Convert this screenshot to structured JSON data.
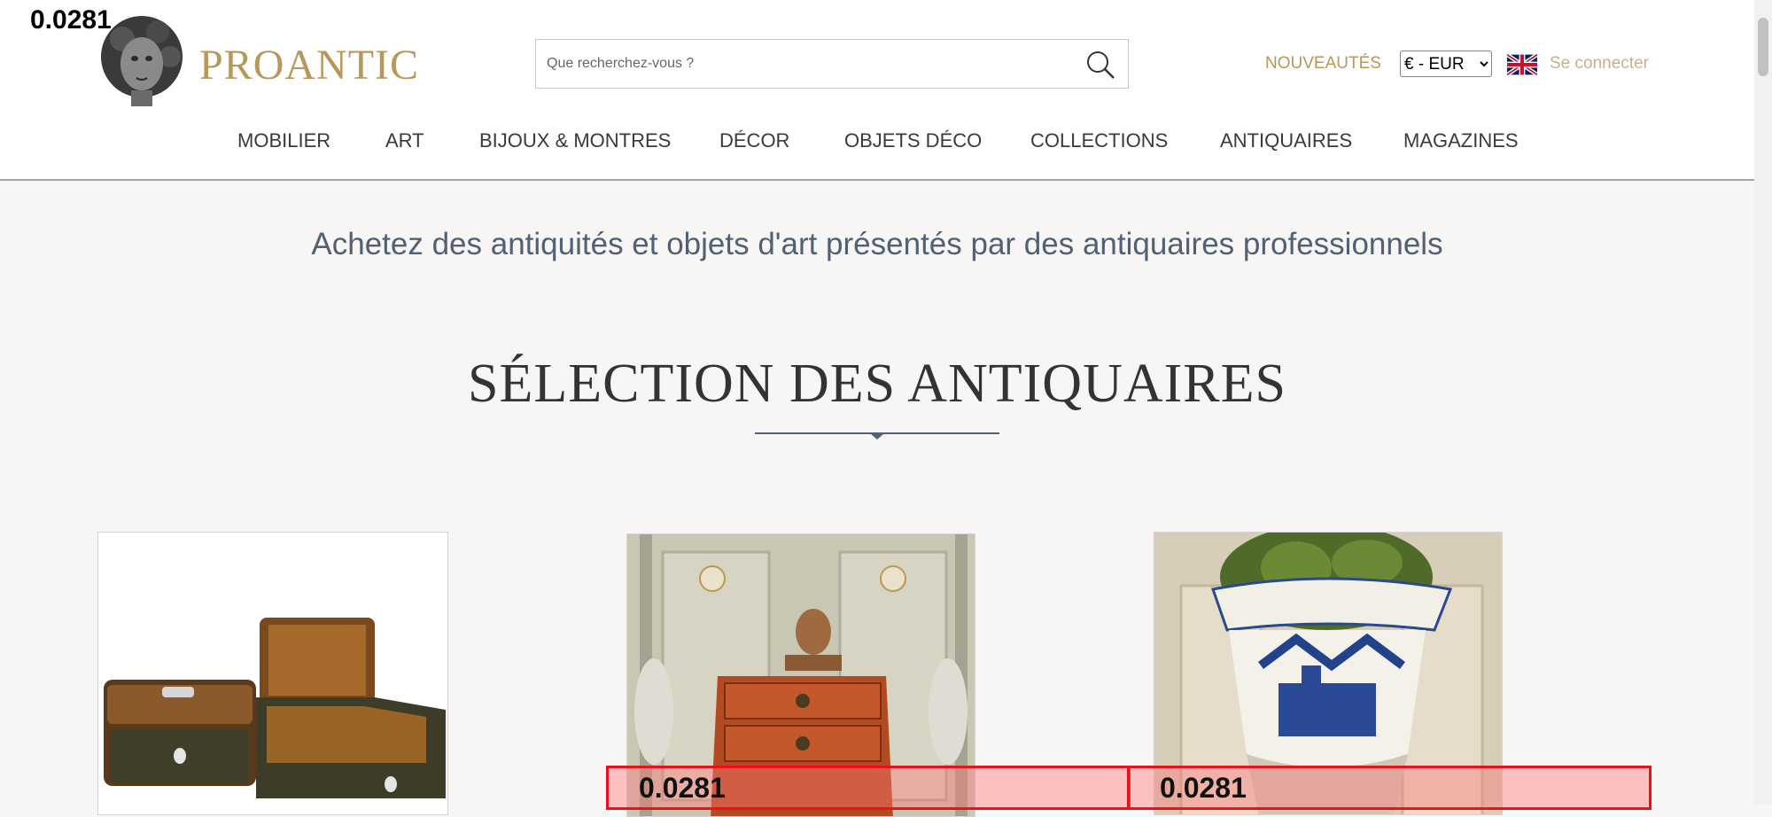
{
  "overlay_value": "0.0281",
  "header": {
    "logo_text": "PROANTIC",
    "search_placeholder": "Que recherchez-vous ?",
    "nouveautes": "NOUVEAUTÉS",
    "currency": "€ - EUR",
    "login": "Se connecter"
  },
  "nav": [
    {
      "label": "MOBILIER"
    },
    {
      "label": "ART"
    },
    {
      "label": "BIJOUX & MONTRES"
    },
    {
      "label": "DÉCOR"
    },
    {
      "label": "OBJETS DÉCO"
    },
    {
      "label": "COLLECTIONS"
    },
    {
      "label": "ANTIQUAIRES"
    },
    {
      "label": "MAGAZINES"
    }
  ],
  "tagline": "Achetez des antiquités et objets d'art présentés par des antiquaires professionnels",
  "section_title": "SÉLECTION DES ANTIQUAIRES",
  "products": [
    {
      "icon": "marquetry-boxes-image"
    },
    {
      "icon": "commode-with-cherub-image"
    },
    {
      "icon": "blue-white-planter-image"
    }
  ],
  "colors": {
    "gold": "#b8985a",
    "nav_text": "#3a3a3a",
    "tagline": "#516072",
    "overlay_border": "#e8121b"
  }
}
